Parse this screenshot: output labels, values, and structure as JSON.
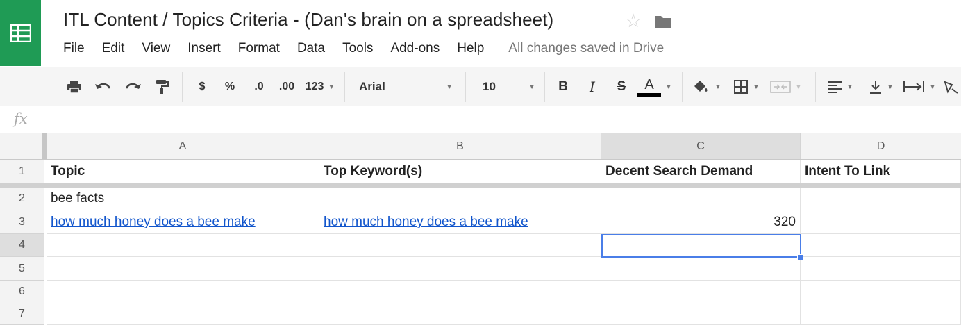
{
  "app": {
    "title": "ITL Content / Topics Criteria - (Dan's brain on a spreadsheet)",
    "save_status": "All changes saved in Drive",
    "brand_color": "#1f9b55"
  },
  "menu": [
    "File",
    "Edit",
    "View",
    "Insert",
    "Format",
    "Data",
    "Tools",
    "Add-ons",
    "Help"
  ],
  "toolbar": {
    "currency": "$",
    "percent": "%",
    "decrease_decimal": ".0",
    "increase_decimal": ".00",
    "more_formats": "123",
    "font": "Arial",
    "font_size": "10",
    "bold": "B",
    "italic": "I",
    "strike": "S",
    "text_color": "A"
  },
  "formula_bar": {
    "fx_label": "fx",
    "value": ""
  },
  "grid": {
    "columns": [
      "A",
      "B",
      "C",
      "D"
    ],
    "active_column": "C",
    "active_row": "4",
    "rows": [
      {
        "num": "1",
        "cells": [
          "Topic",
          "Top Keyword(s)",
          "Decent Search Demand",
          "Intent To Link"
        ]
      },
      {
        "num": "2",
        "cells": [
          "bee facts",
          "",
          "",
          ""
        ]
      },
      {
        "num": "3",
        "cells": [
          "how much honey does a bee make",
          "how much honey does a bee make",
          "320",
          ""
        ]
      },
      {
        "num": "4",
        "cells": [
          "",
          "",
          "",
          ""
        ]
      },
      {
        "num": "5",
        "cells": [
          "",
          "",
          "",
          ""
        ]
      },
      {
        "num": "6",
        "cells": [
          "",
          "",
          "",
          ""
        ]
      },
      {
        "num": "7",
        "cells": [
          "",
          "",
          "",
          ""
        ]
      }
    ]
  }
}
